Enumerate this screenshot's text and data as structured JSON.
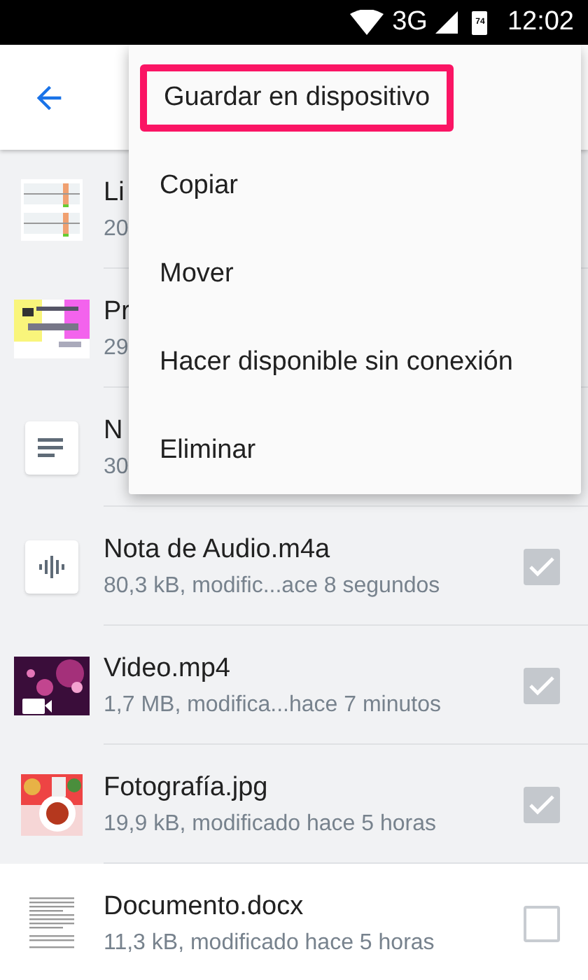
{
  "status_bar": {
    "network": "3G",
    "battery": "74",
    "time": "12:02"
  },
  "files": [
    {
      "kind": "spreadsheet",
      "name": "Li",
      "meta": "20",
      "selected": true
    },
    {
      "kind": "slide",
      "name": "Pr",
      "meta": "29",
      "selected": true
    },
    {
      "kind": "note",
      "name": "N",
      "meta": "30",
      "selected": true
    },
    {
      "kind": "audio",
      "name": "Nota de Audio.m4a",
      "meta": "80,3 kB, modific...ace 8 segundos",
      "selected": true,
      "checked": true
    },
    {
      "kind": "video",
      "name": "Video.mp4",
      "meta": "1,7 MB, modifica...hace 7 minutos",
      "selected": true,
      "checked": true
    },
    {
      "name": "Fotografía.jpg",
      "meta": "19,9 kB, modificado hace 5 horas",
      "selected": true,
      "checked": true
    },
    {
      "kind": "document",
      "name": "Documento.docx",
      "meta": "11,3 kB, modificado hace 5 horas",
      "selected": false,
      "checked": false
    }
  ],
  "menu": [
    {
      "label": "Guardar en dispositivo",
      "highlighted": true
    },
    {
      "label": "Copiar",
      "highlighted": false
    },
    {
      "label": "Mover",
      "highlighted": false
    },
    {
      "label": "Hacer disponible sin conexión",
      "highlighted": false
    },
    {
      "label": "Eliminar",
      "highlighted": false
    }
  ]
}
